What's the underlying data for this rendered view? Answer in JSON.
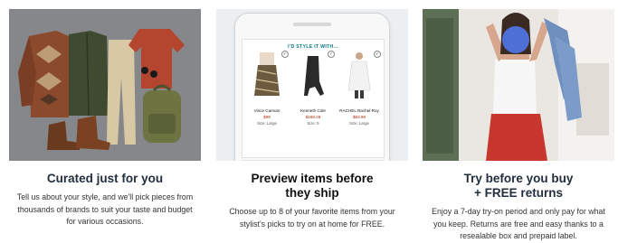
{
  "columns": [
    {
      "title": "Curated just for you",
      "description": "Tell us about your style, and we'll pick pieces from thousands of brands to suit your taste and budget for various occasions."
    },
    {
      "title_line1": "Preview items before",
      "title_line2": "they ship",
      "description": "Choose up to 8 of your favorite items from your stylist's picks to try on at home for FREE.",
      "phone": {
        "header": "I'D STYLE IT WITH...",
        "items": [
          {
            "brand": "Vince Camuto",
            "price": "$99",
            "size": "Size: Large"
          },
          {
            "brand": "Kenneth Cole",
            "price": "$168.26",
            "size": "Size: 9"
          },
          {
            "brand": "RACHEL Rachel Roy",
            "price": "$83.96",
            "size": "Size: Large"
          }
        ]
      }
    },
    {
      "title_line1": "Try before you buy",
      "title_line2": "+ FREE returns",
      "description": "Enjoy a 7-day try-on period and only pay for what you keep. Returns are free and easy thanks to a resealable box and prepaid label."
    }
  ]
}
